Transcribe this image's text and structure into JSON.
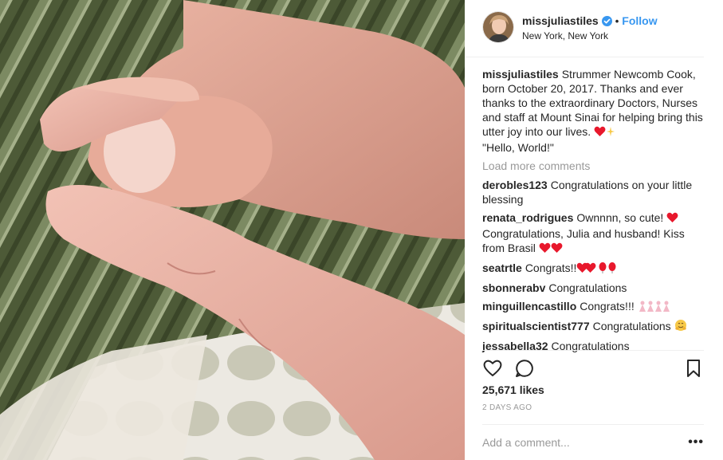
{
  "post": {
    "username": "missjuliastiles",
    "follow_label": "Follow",
    "location": "New York, New York",
    "caption": {
      "user": "missjuliastiles",
      "text": "Strummer Newcomb Cook, born October 20, 2017. Thanks and ever thanks to the extraordinary Doctors, Nurses and staff at Mount Sinai for helping bring this utter joy into our lives.",
      "text2": "\"Hello, World!\""
    },
    "load_more_label": "Load more comments",
    "comments": [
      {
        "user": "derobles123",
        "text": "Congratulations on your little blessing"
      },
      {
        "user": "renata_rodrigues",
        "text": "Ownnnn, so cute!",
        "text2": "Congratulations, Julia and husband! Kiss from Brasil"
      },
      {
        "user": "seatrtle",
        "text": "Congrats!!"
      },
      {
        "user": "sbonnerabv",
        "text": "Congratulations"
      },
      {
        "user": "minguillencastillo",
        "text": "Congrats!!!"
      },
      {
        "user": "spiritualscientist777",
        "text": "Congratulations"
      },
      {
        "user": "jessabella32",
        "text": "Congratulations"
      }
    ],
    "likes": "25,671 likes",
    "time_ago": "2 DAYS AGO",
    "add_comment_placeholder": "Add a comment...",
    "more_glyph": "•••",
    "colors": {
      "link": "#3897f0",
      "heart": "#e8182c",
      "muted": "#999999"
    },
    "icons": [
      "verified-badge-icon",
      "heart-icon",
      "comment-icon",
      "bookmark-icon",
      "more-options-icon"
    ]
  }
}
